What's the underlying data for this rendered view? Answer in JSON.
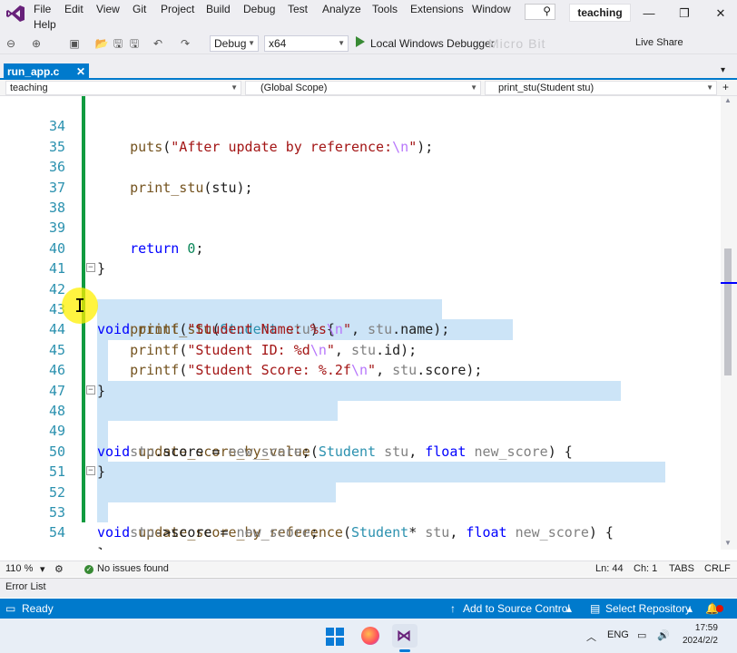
{
  "menu": {
    "items": [
      "File",
      "Edit",
      "View",
      "Git",
      "Project",
      "Build",
      "Debug",
      "Test",
      "Analyze",
      "Tools",
      "Extensions",
      "Window",
      "Help"
    ],
    "solution_name": "teaching"
  },
  "toolbar": {
    "config": "Debug",
    "platform": "x64",
    "run_label": "Local Windows Debugger",
    "watermark": "Micro Bit",
    "live_share": "Live Share"
  },
  "tabs": [
    {
      "label": "run_app.c",
      "active": true
    }
  ],
  "navbar": {
    "project": "teaching",
    "scope": "(Global Scope)",
    "member": "print_stu(Student stu)"
  },
  "editor": {
    "lines": [
      {
        "num": "34",
        "text": "    puts(\"After update by reference:\\n\");"
      },
      {
        "num": "35",
        "text": ""
      },
      {
        "num": "36",
        "text": "    print_stu(stu);"
      },
      {
        "num": "37",
        "text": ""
      },
      {
        "num": "38",
        "text": ""
      },
      {
        "num": "39",
        "text": "    return 0;"
      },
      {
        "num": "40",
        "text": "}"
      },
      {
        "num": "41",
        "text": ""
      },
      {
        "num": "42",
        "text": "void print_stu(Student stu) {"
      },
      {
        "num": "43",
        "text": "    printf(\"Student Name: %s\\n\", stu.name);"
      },
      {
        "num": "44",
        "text": "    printf(\"Student ID: %d\\n\", stu.id);"
      },
      {
        "num": "45",
        "text": "    printf(\"Student Score: %.2f\\n\", stu.score);"
      },
      {
        "num": "46",
        "text": "}"
      },
      {
        "num": "47",
        "text": ""
      },
      {
        "num": "48",
        "text": "void update_score_by_value(Student stu, float new_score) {"
      },
      {
        "num": "49",
        "text": "    stu.score = new_score;"
      },
      {
        "num": "50",
        "text": "}"
      },
      {
        "num": "51",
        "text": ""
      },
      {
        "num": "52",
        "text": "void update_score_by_reference(Student* stu, float new_score) {"
      },
      {
        "num": "53",
        "text": "    stu->score = new_score;"
      },
      {
        "num": "54",
        "text": "}"
      }
    ]
  },
  "editor_status": {
    "zoom": "110 %",
    "issues": "No issues found",
    "line": "Ln: 44",
    "col": "Ch: 1",
    "indent": "TABS",
    "eol": "CRLF"
  },
  "error_list": {
    "label": "Error List"
  },
  "statusbar": {
    "state": "Ready",
    "source_control": "Add to Source Control",
    "repository": "Select Repository"
  },
  "taskbar": {
    "lang": "ENG",
    "time": "17:59",
    "date": "2024/2/2"
  },
  "colors": {
    "accent": "#007acc",
    "selection": "#cce4f7",
    "change_bar": "#109b3f"
  }
}
